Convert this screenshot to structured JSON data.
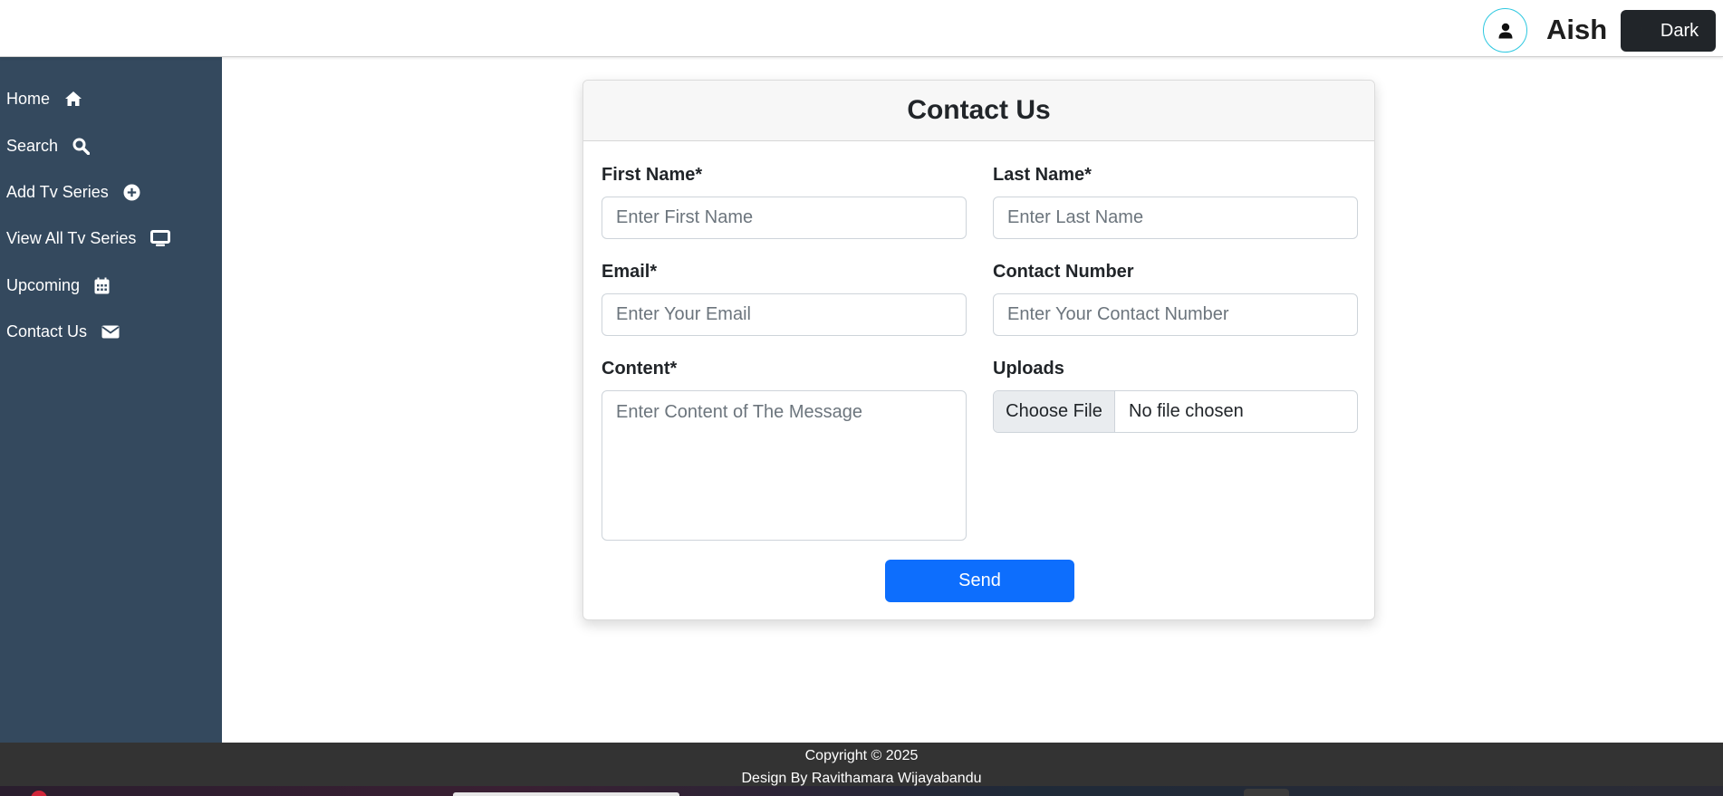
{
  "header": {
    "username": "Aish",
    "avatar_icon": "user-icon",
    "theme_toggle": {
      "icon": "moon-icon",
      "label": "Dark"
    }
  },
  "sidebar": {
    "items": [
      {
        "label": "Home",
        "icon": "home-icon"
      },
      {
        "label": "Search",
        "icon": "search-icon"
      },
      {
        "label": "Add Tv Series",
        "icon": "plus-circle-icon"
      },
      {
        "label": "View All Tv Series",
        "icon": "tv-icon"
      },
      {
        "label": "Upcoming",
        "icon": "calendar-icon"
      },
      {
        "label": "Contact Us",
        "icon": "envelope-icon"
      }
    ]
  },
  "form": {
    "title": "Contact Us",
    "first_name": {
      "label": "First Name*",
      "placeholder": "Enter First Name"
    },
    "last_name": {
      "label": "Last Name*",
      "placeholder": "Enter Last Name"
    },
    "email": {
      "label": "Email*",
      "placeholder": "Enter Your Email"
    },
    "contact_number": {
      "label": "Contact Number",
      "placeholder": "Enter Your Contact Number"
    },
    "content": {
      "label": "Content*",
      "placeholder": "Enter Content of The Message"
    },
    "uploads": {
      "label": "Uploads",
      "button": "Choose File",
      "status": "No file chosen"
    },
    "send_label": "Send"
  },
  "footer": {
    "copyright": "Copyright © 2025",
    "credit": "Design By Ravithamara Wijayabandu"
  },
  "colors": {
    "sidebar_bg": "#34495e",
    "primary": "#0d6efd",
    "footer_bg": "#333333",
    "avatar_ring": "#2ec8e0"
  }
}
